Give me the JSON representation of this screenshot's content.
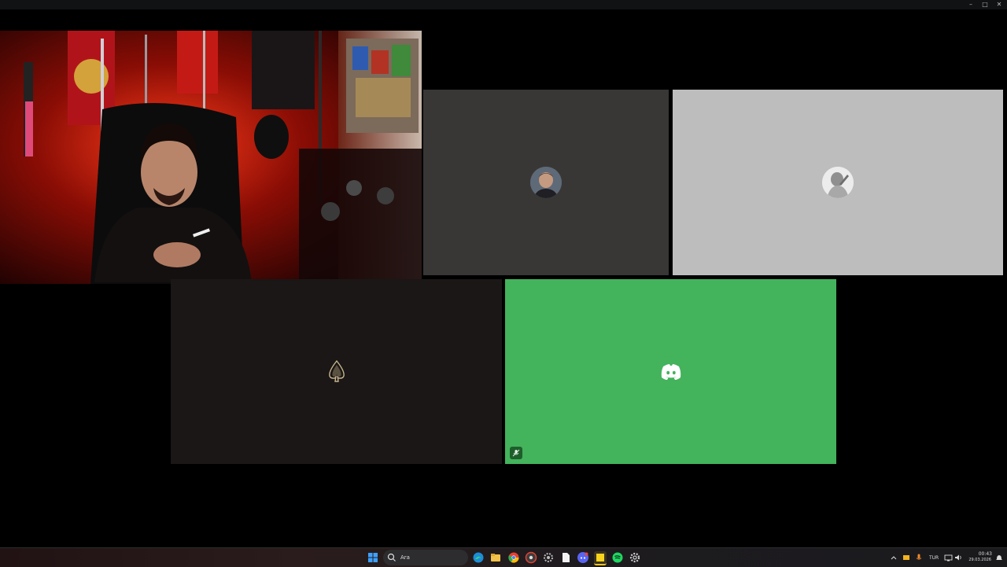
{
  "window": {
    "minimize_glyph": "–",
    "maximize_glyph": "□",
    "close_glyph": "✕"
  },
  "participants": [
    {
      "id": "camera",
      "kind": "live-video"
    },
    {
      "id": "user1",
      "kind": "avatar-photo",
      "tile_color": "#393735"
    },
    {
      "id": "user2",
      "kind": "avatar-photo",
      "tile_color": "#bdbdbd"
    },
    {
      "id": "user3",
      "kind": "spade-icon",
      "tile_color": "#1a1716"
    },
    {
      "id": "user4",
      "kind": "discord-logo-icon",
      "tile_color": "#43b35c",
      "muted": true
    }
  ],
  "taskbar": {
    "search_placeholder": "Ara",
    "pinned_apps": [
      "edge-icon",
      "file-explorer-icon",
      "chrome-icon",
      "chrome-alt-icon",
      "settings-dark-icon",
      "file-icon",
      "discord-icon",
      "sticky-notes-icon",
      "spotify-icon",
      "settings-icon"
    ],
    "tray": {
      "language": "TUR",
      "time": "00:43",
      "date": "29.03.2026"
    }
  },
  "colors": {
    "accent_green": "#43b35c",
    "background": "#000000"
  }
}
